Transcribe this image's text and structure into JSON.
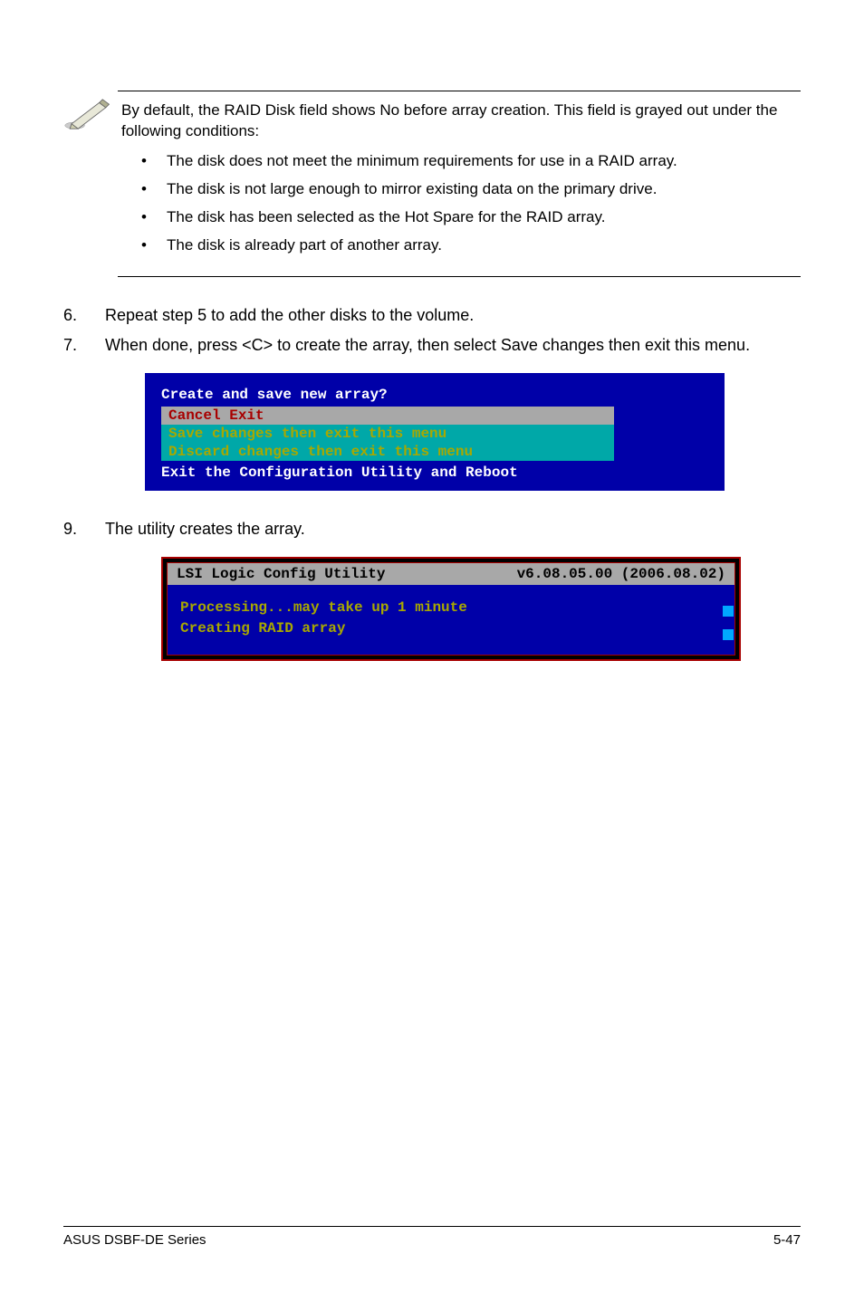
{
  "note": {
    "intro": "By default, the RAID Disk field shows No before array creation. This field is grayed out under the following conditions:",
    "items": [
      "The disk does not meet the  minimum requirements for use in a RAID array.",
      "The disk is not large enough to mirror existing data on the primary drive.",
      "The disk has been selected as the Hot Spare for the RAID array.",
      "The disk is already part of another array."
    ]
  },
  "steps": {
    "s6": {
      "num": "6.",
      "text": "Repeat step 5 to add the other disks to the volume."
    },
    "s7": {
      "num": "7.",
      "text": "When done, press <C> to create the array, then select Save changes then exit this menu."
    },
    "s9": {
      "num": "9.",
      "text": "The utility creates the array."
    }
  },
  "bios1": {
    "prompt": "Create and save new array?",
    "menu": [
      "Cancel Exit",
      "Save changes then exit this menu",
      "Discard changes then exit this menu"
    ],
    "footer": "Exit the Configuration Utility and Reboot"
  },
  "bios2": {
    "title_left": "LSI Logic Config Utility",
    "title_right": "v6.08.05.00 (2006.08.02)",
    "lines": [
      "Processing...may take up 1 minute",
      "Creating RAID array"
    ]
  },
  "footer": {
    "left": "ASUS DSBF-DE Series",
    "right": "5-47"
  }
}
